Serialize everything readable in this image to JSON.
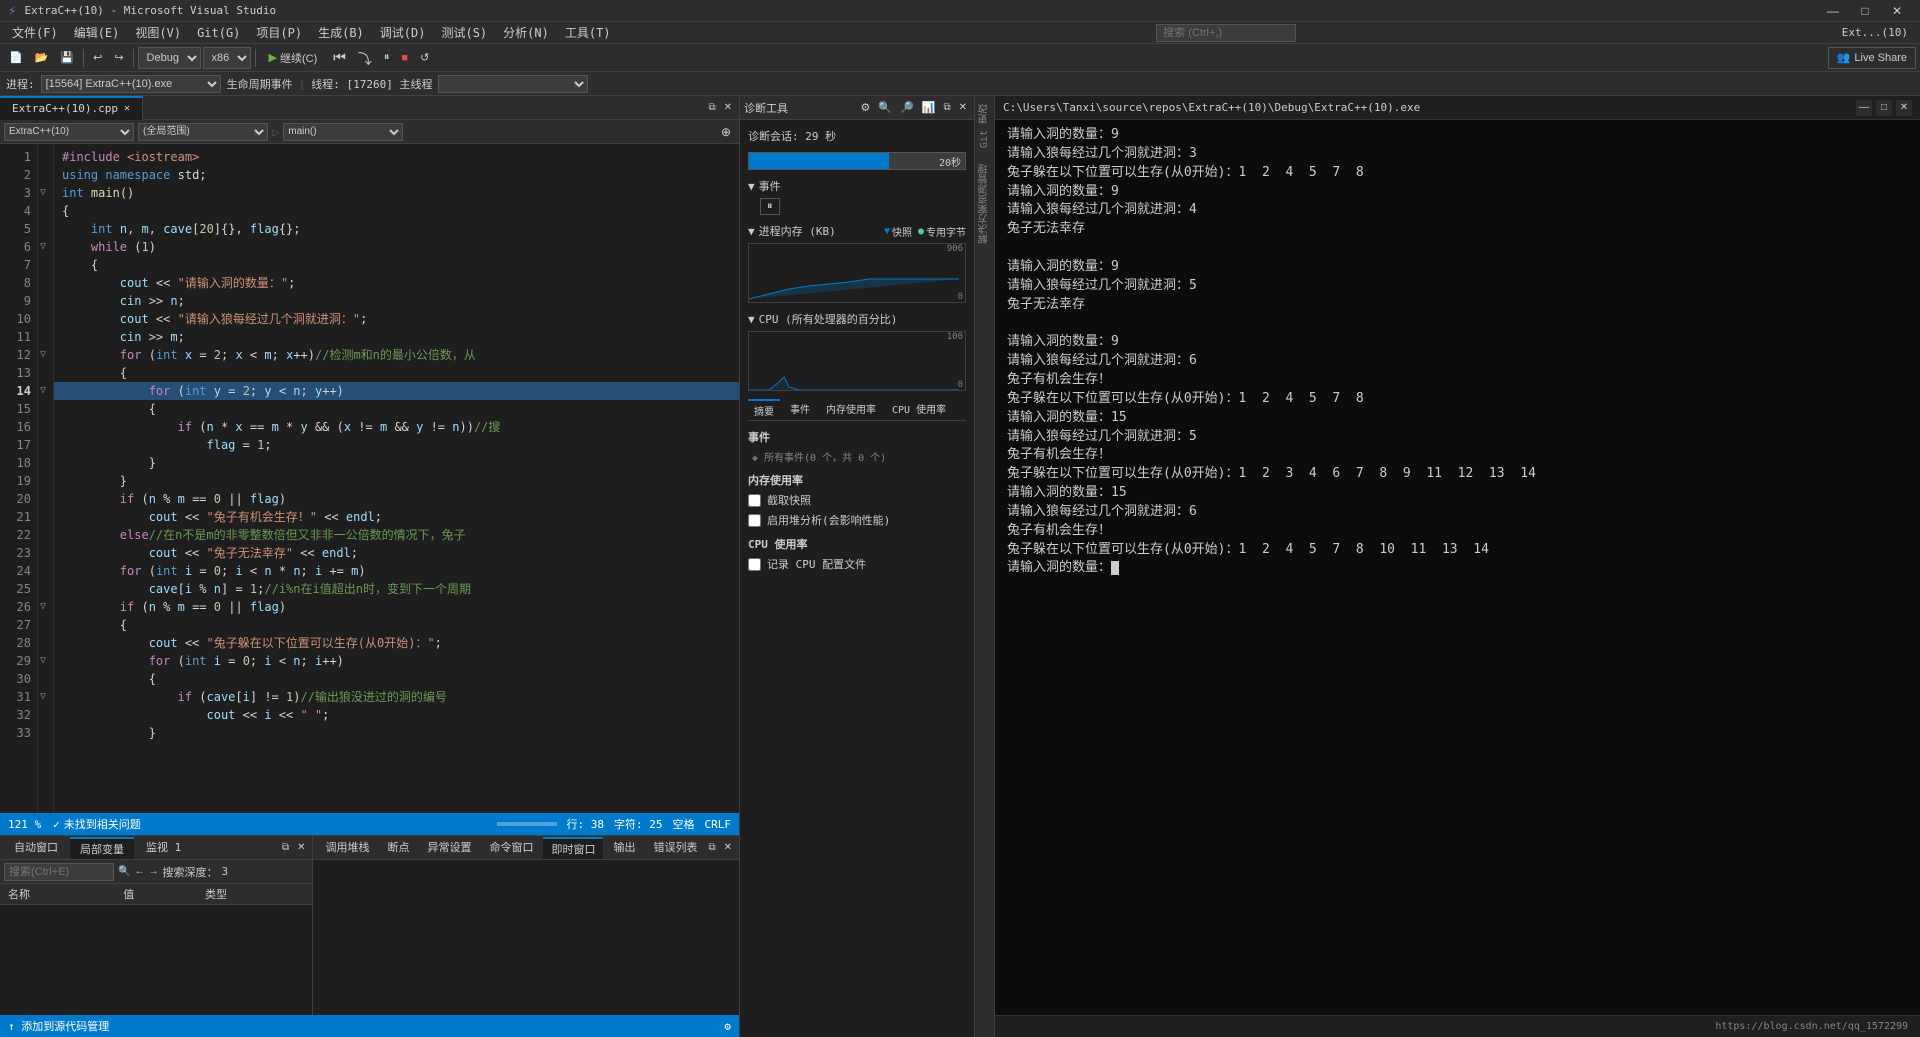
{
  "app": {
    "title": "ExtraC++(10) - Microsoft Visual Studio",
    "process_title": "C:\\Users\\Tanxi\\source\\repos\\ExtraC++(10)\\Debug\\ExtraC++(10).exe"
  },
  "menu": {
    "items": [
      "文件(F)",
      "编辑(E)",
      "视图(V)",
      "Git(G)",
      "项目(P)",
      "生成(B)",
      "调试(D)",
      "测试(S)",
      "分析(N)",
      "工具(T)"
    ]
  },
  "toolbar": {
    "debug_config": "Debug",
    "platform": "x86",
    "continue_label": "继续(C)",
    "live_share": "Live Share",
    "search_placeholder": "搜索 (Ctrl+,)",
    "ext_label": "Ext...(10)"
  },
  "process_bar": {
    "process_label": "进程:",
    "process_value": "[15564] ExtraC++(10).exe",
    "lifecycle_label": "生命周期事件",
    "thread_label": "线程: [17260] 主线程"
  },
  "editor": {
    "tab_name": "ExtraC++(10).cpp",
    "file_label": "ExtraC++(10)",
    "scope_label": "(全局范围)",
    "function_label": "main()",
    "lines": [
      {
        "num": 1,
        "code": "#include <iostream>",
        "indent": 4
      },
      {
        "num": 2,
        "code": "using namespace std;",
        "indent": 4
      },
      {
        "num": 3,
        "code": "int main()",
        "indent": 0
      },
      {
        "num": 4,
        "code": "{",
        "indent": 0
      },
      {
        "num": 5,
        "code": "    int n, m, cave[20]{}, flag{};",
        "indent": 4
      },
      {
        "num": 6,
        "code": "    while (1)",
        "indent": 4
      },
      {
        "num": 7,
        "code": "    {",
        "indent": 4
      },
      {
        "num": 8,
        "code": "        cout << \"请输入洞的数量：\";",
        "indent": 8
      },
      {
        "num": 9,
        "code": "        cin >> n;",
        "indent": 8
      },
      {
        "num": 10,
        "code": "        cout << \"请输入狼每经过几个洞就进洞：\";",
        "indent": 8
      },
      {
        "num": 11,
        "code": "        cin >> m;",
        "indent": 8
      },
      {
        "num": 12,
        "code": "        for (int x = 2; x < m; x++)//检测m和n的最小公倍数，从",
        "indent": 8
      },
      {
        "num": 13,
        "code": "        {",
        "indent": 8
      },
      {
        "num": 14,
        "code": "            for (int y = 2; y < n; y++)",
        "indent": 12
      },
      {
        "num": 15,
        "code": "            {",
        "indent": 12
      },
      {
        "num": 16,
        "code": "                if (n * x == m * y && (x != m && y != n))//搜",
        "indent": 16
      },
      {
        "num": 17,
        "code": "                    flag = 1;",
        "indent": 16
      },
      {
        "num": 18,
        "code": "            }",
        "indent": 12
      },
      {
        "num": 19,
        "code": "        }",
        "indent": 8
      },
      {
        "num": 20,
        "code": "        if (n % m == 0 || flag)",
        "indent": 8
      },
      {
        "num": 21,
        "code": "            cout << \"兔子有机会生存！\" << endl;",
        "indent": 12
      },
      {
        "num": 22,
        "code": "        else//在n不是m的非零整数倍但又非非一公倍数的情况下，兔子",
        "indent": 8
      },
      {
        "num": 23,
        "code": "            cout << \"兔子无法幸存\" << endl;",
        "indent": 12
      },
      {
        "num": 24,
        "code": "        for (int i = 0; i < n * n; i += m)",
        "indent": 8
      },
      {
        "num": 25,
        "code": "            cave[i % n] = 1;//i%n在i值超出n时，变到下一个周期",
        "indent": 12
      },
      {
        "num": 26,
        "code": "        if (n % m == 0 || flag)",
        "indent": 8
      },
      {
        "num": 27,
        "code": "        {",
        "indent": 8
      },
      {
        "num": 28,
        "code": "            cout << \"兔子躲在以下位置可以生存(从0开始)：\";",
        "indent": 12
      },
      {
        "num": 29,
        "code": "            for (int i = 0; i < n; i++)",
        "indent": 12
      },
      {
        "num": 30,
        "code": "            {",
        "indent": 12
      },
      {
        "num": 31,
        "code": "                if (cave[i] != 1)//输出狼没进过的洞的编号",
        "indent": 16
      },
      {
        "num": 32,
        "code": "                    cout << i << \" \";",
        "indent": 16
      },
      {
        "num": 33,
        "code": "            }",
        "indent": 12
      }
    ]
  },
  "status_bar": {
    "no_errors": "未找到相关问题",
    "line": "行: 38",
    "col": "字符: 25",
    "spaces": "空格",
    "encoding": "CRLF",
    "zoom": "121 %"
  },
  "diagnostics": {
    "title": "诊断工具",
    "session_time": "诊断会话: 29 秒",
    "progress_value": "20秒",
    "events_label": "事件",
    "memory_label": "进程内存 (KB)",
    "memory_legend_fast": "快照",
    "memory_legend_special": "专用字节",
    "memory_max": "906",
    "memory_min": "0",
    "cpu_label": "CPU (所有处理器的百分比)",
    "cpu_max": "100",
    "cpu_min": "0",
    "tabs": [
      "摘要",
      "事件",
      "内存使用率",
      "CPU 使用率"
    ],
    "events_section_title": "事件",
    "events_section_subtitle": "◈ 所有事件(0 个，共 0 个)",
    "memory_section_title": "内存使用率",
    "memory_check1": "截取快照",
    "memory_check2": "启用堆分析(会影响性能)",
    "cpu_section_title": "CPU 使用率",
    "cpu_check": "记录 CPU 配置文件"
  },
  "bottom_left": {
    "panels": [
      "自动窗口",
      "局部变量",
      "监视 1"
    ],
    "locals_tab": "局部变量",
    "search_placeholder": "搜索(Ctrl+E)",
    "depth_label": "搜索深度：",
    "depth_value": "3",
    "columns": [
      "名称",
      "值",
      "类型"
    ]
  },
  "bottom_right": {
    "panels": [
      "调用堆栈",
      "断点",
      "异常设置",
      "命令窗口",
      "即时窗口",
      "输出",
      "错误列表"
    ],
    "active_tab": "即时窗口",
    "title": "即时窗口"
  },
  "console": {
    "title": "C:\\Users\\Tanxi\\source\\repos\\ExtraC++(10)\\Debug\\ExtraC++(10).exe",
    "lines": [
      "请输入洞的数量：9",
      "请输入狼每经过几个洞就进洞：3",
      "兔子躲在以下位置可以生存(从0开始)：1  2  4  5  7  8",
      "请输入洞的数量：9",
      "请输入狼每经过几个洞就进洞：4",
      "兔子无法幸存",
      "",
      "请输入洞的数量：9",
      "请输入狼每经过几个洞就进洞：5",
      "兔子无法幸存",
      "",
      "请输入洞的数量：9",
      "请输入狼每经过几个洞就进洞：6",
      "兔子有机会生存！",
      "兔子躲在以下位置可以生存(从0开始)：1  2  4  5  7  8",
      "请输入洞的数量：15",
      "请输入狼每经过几个洞就进洞：5",
      "兔子有机会生存！",
      "兔子躲在以下位置可以生存(从0开始)：1  2  3  4  6  7  8  9  11  12  13  14",
      "请输入洞的数量：15",
      "请输入狼每经过几个洞就进洞：6",
      "兔子有机会生存！",
      "兔子躲在以下位置可以生存(从0开始)：1  2  4  5  7  8  10  11  13  14",
      "请输入洞的数量：_"
    ],
    "bottom_url": "https://blog.csdn.net/qq_1572299"
  },
  "window_controls": {
    "minimize": "—",
    "maximize": "□",
    "close": "✕"
  }
}
